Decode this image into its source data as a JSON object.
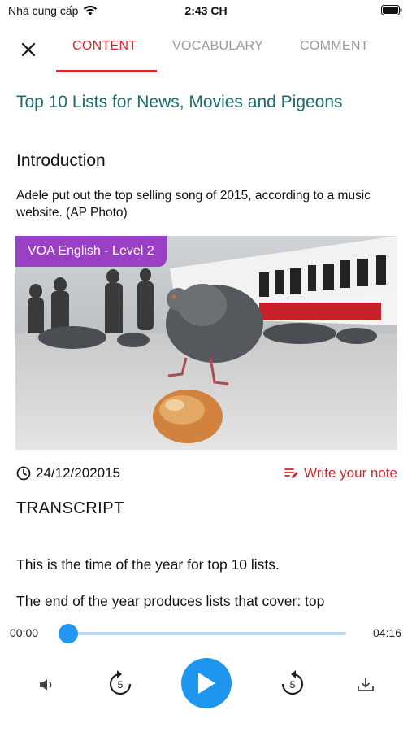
{
  "status_bar": {
    "carrier": "Nhà cung cấp",
    "time": "2:43 CH"
  },
  "nav": {
    "close_icon": "close-icon",
    "tabs": [
      {
        "label": "CONTENT",
        "active": true
      },
      {
        "label": "VOCABULARY",
        "active": false
      },
      {
        "label": "COMMENT",
        "active": false
      }
    ]
  },
  "article": {
    "title": "Top 10 Lists for News, Movies and Pigeons",
    "section_title": "Introduction",
    "intro": "Adele put out the top selling song of 2015, according to a music website. (AP Photo)",
    "level_badge": "VOA English - Level 2",
    "date": "24/12/202015",
    "write_note": "Write your note",
    "transcript_title": "TRANSCRIPT",
    "transcript_lines": [
      "This is the time of the year for top 10 lists.",
      "The end of the year produces lists that cover: top"
    ]
  },
  "player": {
    "current_time": "00:00",
    "total_time": "04:16",
    "progress": 0,
    "skip_seconds": "5"
  },
  "colors": {
    "accent_red": "#d7262b",
    "title_teal": "#1c6b6b",
    "badge_purple": "#9b3fc5",
    "player_blue": "#1e96f0"
  }
}
